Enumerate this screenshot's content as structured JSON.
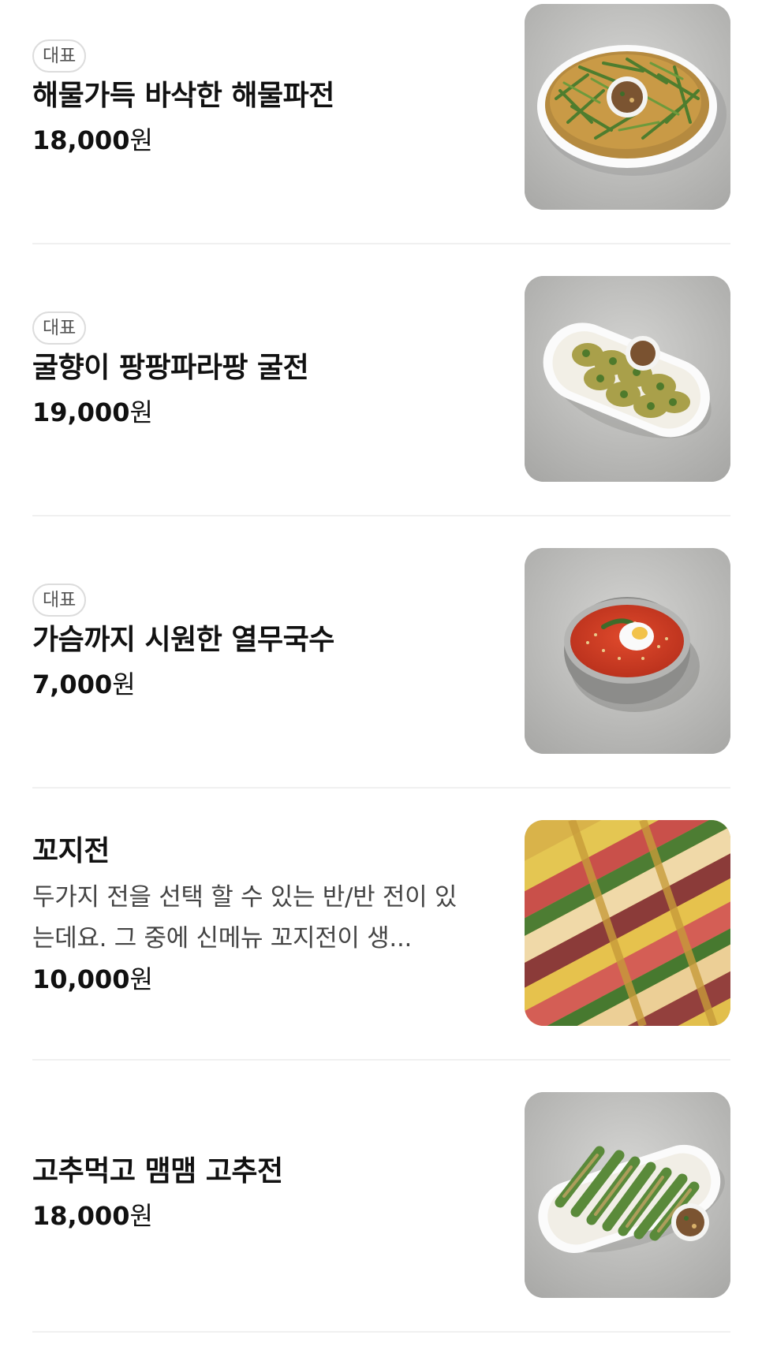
{
  "menu": {
    "items": [
      {
        "badge": "대표",
        "name": "해물가득 바삭한 해물파전",
        "price": "18,000",
        "currency": "원",
        "image": "seafood-pancake-photo"
      },
      {
        "badge": "대표",
        "name": "굴향이 팡팡파라팡 굴전",
        "price": "19,000",
        "currency": "원",
        "image": "oyster-pancake-photo"
      },
      {
        "badge": "대표",
        "name": "가슴까지 시원한 열무국수",
        "price": "7,000",
        "currency": "원",
        "image": "young-radish-noodles-photo"
      },
      {
        "name": "꼬지전",
        "description": "두가지 전을 선택 할 수 있는 반/반 전이 있는데요. 그 중에 신메뉴 꼬지전이 생...",
        "price": "10,000",
        "currency": "원",
        "image": "skewer-pancake-photo"
      },
      {
        "name": "고추먹고 맴맴 고추전",
        "price": "18,000",
        "currency": "원",
        "image": "pepper-pancake-photo"
      }
    ]
  },
  "colors": {
    "text": "#111111",
    "secondary_text": "#444444",
    "badge_border": "#dcdcdc",
    "divider": "#f0f0f0",
    "background": "#ffffff"
  }
}
